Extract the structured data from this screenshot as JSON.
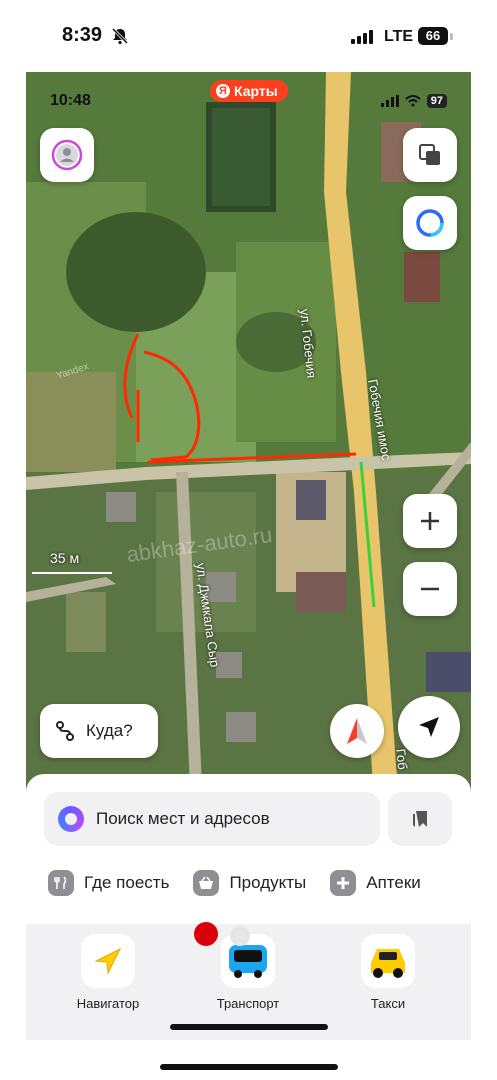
{
  "outer_status": {
    "time": "8:39",
    "network": "LTE",
    "battery": "66"
  },
  "inner_status": {
    "time": "10:48",
    "battery": "97"
  },
  "app": {
    "brand_letter": "Я",
    "brand_name": "Карты"
  },
  "map": {
    "scale_label": "35 м",
    "streets": [
      "ул. Гобечия",
      "Гобечия имос",
      "ул. Джмкала Сыр",
      "Гоб"
    ],
    "watermark": "abkhaz-auto.ru",
    "provider_mark": "Yandex"
  },
  "route_button": {
    "label": "Куда?"
  },
  "search": {
    "placeholder": "Поиск мест и адресов"
  },
  "categories": [
    {
      "label": "Где поесть",
      "icon": "fork-knife-icon"
    },
    {
      "label": "Продукты",
      "icon": "basket-icon"
    },
    {
      "label": "Аптеки",
      "icon": "pharmacy-cross-icon"
    }
  ],
  "tabs": [
    {
      "label": "Навигатор",
      "icon": "navigator-arrow-icon"
    },
    {
      "label": "Транспорт",
      "icon": "bus-icon"
    },
    {
      "label": "Такси",
      "icon": "taxi-car-icon"
    }
  ],
  "colors": {
    "accent_red": "#fc3f1d",
    "road": "#e8c46a",
    "annotation_red": "#ff2a00",
    "route_green": "#3ccf3c",
    "sheet_bg": "#ffffff"
  }
}
